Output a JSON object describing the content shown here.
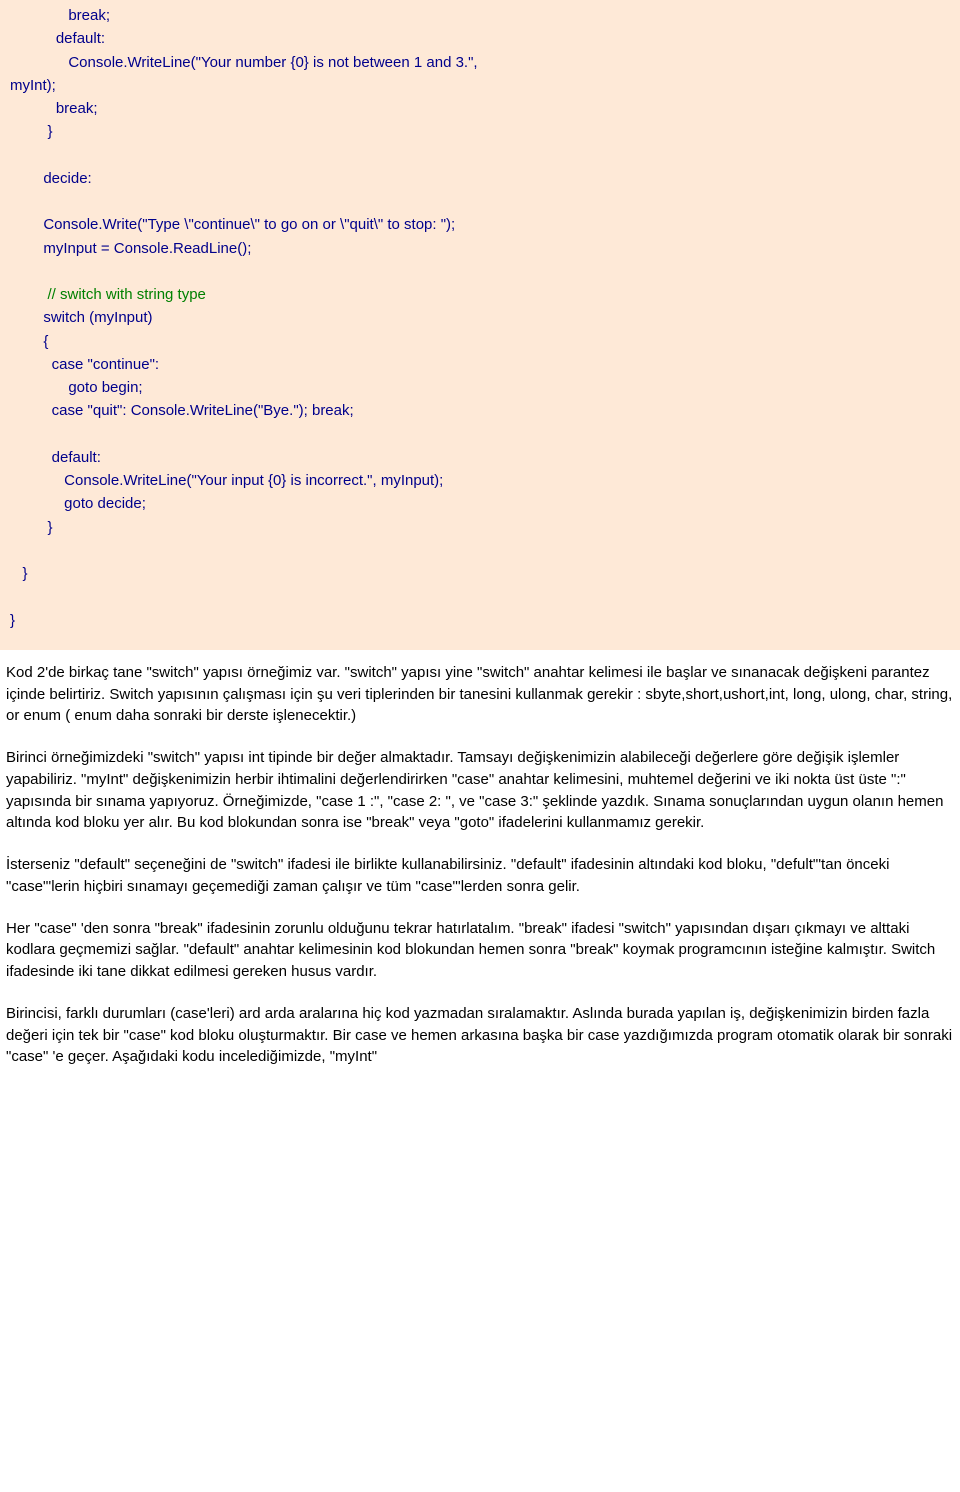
{
  "code": {
    "l1": "              break;",
    "l2": "           default:",
    "l3": "              Console.WriteLine(\"Your number {0} is not between 1 and 3.\",",
    "l4": "myInt);",
    "l5": "           break;",
    "l6": "         }",
    "l7": "",
    "l8": "        decide:",
    "l9": "",
    "l10": "        Console.Write(\"Type \\\"continue\\\" to go on or \\\"quit\\\" to stop: \");",
    "l11": "        myInput = Console.ReadLine();",
    "l12": "",
    "l13a": "         ",
    "l13b": "// switch with string type",
    "l14": "        switch (myInput)",
    "l15": "        {",
    "l16": "          case \"continue\":",
    "l17": "              goto begin;",
    "l18": "          case \"quit\": Console.WriteLine(\"Bye.\"); break;",
    "l19": "",
    "l20": "          default:",
    "l21": "             Console.WriteLine(\"Your input {0} is incorrect.\", myInput);",
    "l22": "             goto decide;",
    "l23": "         }",
    "l24": "",
    "l25": "   }",
    "l26": "",
    "l27": "}"
  },
  "prose": {
    "p1": "Kod 2'de birkaç tane \"switch\" yapısı örneğimiz var. \"switch\" yapısı yine \"switch\" anahtar kelimesi ile başlar ve sınanacak değişkeni parantez içinde belirtiriz. Switch yapısının çalışması için şu veri tiplerinden bir tanesini kullanmak gerekir : sbyte,short,ushort,int, long, ulong, char, string, or enum ( enum daha sonraki bir derste işlenecektir.)",
    "p2": "Birinci örneğimizdeki \"switch\" yapısı int tipinde bir değer almaktadır. Tamsayı değişkenimizin alabileceği değerlere göre değişik işlemler yapabiliriz. \"myInt\" değişkenimizin herbir ihtimalini değerlendirirken \"case\" anahtar kelimesini, muhtemel değerini ve iki nokta üst üste \":\" yapısında bir sınama yapıyoruz. Örneğimizde, \"case 1 :\", \"case 2: \", ve \"case 3:\" şeklinde yazdık. Sınama sonuçlarından uygun olanın hemen altında kod bloku yer alır. Bu kod blokundan sonra ise \"break\" veya \"goto\" ifadelerini kullanmamız gerekir.",
    "p3": "İsterseniz \"default\" seçeneğini de \"switch\" ifadesi ile birlikte kullanabilirsiniz. \"default\" ifadesinin altındaki kod bloku, \"defult\"'tan önceki \"case\"'lerin hiçbiri sınamayı geçemediği zaman çalışır ve tüm \"case\"'lerden sonra gelir.",
    "p4": "Her \"case\" 'den sonra \"break\" ifadesinin zorunlu olduğunu tekrar hatırlatalım. \"break\" ifadesi \"switch\" yapısından dışarı çıkmayı ve alttaki kodlara geçmemizi sağlar. \"default\" anahtar kelimesinin kod blokundan hemen sonra \"break\" koymak programcının isteğine kalmıştır. Switch ifadesinde iki tane dikkat edilmesi gereken husus vardır.",
    "p5": "Birincisi, farklı durumları (case'leri) ard arda aralarına hiç kod yazmadan sıralamaktır. Aslında burada yapılan iş, değişkenimizin birden fazla değeri için tek bir \"case\" kod bloku oluşturmaktır. Bir case ve hemen arkasına başka bir case yazdığımızda program otomatik olarak bir sonraki \"case\" 'e geçer. Aşağıdaki kodu incelediğimizde, \"myInt\""
  }
}
